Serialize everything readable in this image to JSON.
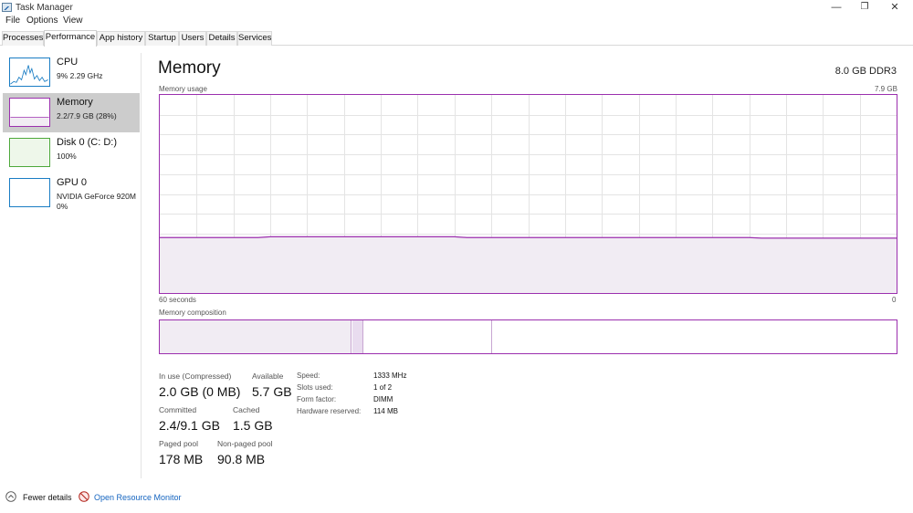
{
  "window": {
    "title": "Task Manager",
    "buttons": {
      "minimize": "—",
      "restore": "❐",
      "close": "✕"
    }
  },
  "menu": [
    "File",
    "Options",
    "View"
  ],
  "tabs": [
    "Processes",
    "Performance",
    "App history",
    "Startup",
    "Users",
    "Details",
    "Services"
  ],
  "active_tab": "Performance",
  "sidebar": {
    "items": [
      {
        "name": "CPU",
        "sub1": "9% 2.29 GHz",
        "sub2": "",
        "icon": "cpu-graph-thumbnail",
        "color": "#1a7dc4"
      },
      {
        "name": "Memory",
        "sub1": "2.2/7.9 GB (28%)",
        "sub2": "",
        "icon": "memory-graph-thumbnail",
        "color": "#9b2fae"
      },
      {
        "name": "Disk 0 (C: D:)",
        "sub1": "100%",
        "sub2": "",
        "icon": "disk-graph-thumbnail",
        "color": "#4da83a"
      },
      {
        "name": "GPU 0",
        "sub1": "NVIDIA GeForce 920M",
        "sub2": "0%",
        "icon": "gpu-graph-thumbnail",
        "color": "#1a7dc4"
      }
    ],
    "selected": "Memory"
  },
  "main": {
    "title": "Memory",
    "spec": "8.0 GB DDR3",
    "usage_label": "Memory usage",
    "usage_max": "7.9 GB",
    "time_left": "60 seconds",
    "time_right": "0",
    "composition_label": "Memory composition",
    "usage_fraction": 0.28
  },
  "stats": {
    "in_use_label": "In use (Compressed)",
    "in_use": "2.0 GB (0 MB)",
    "available_label": "Available",
    "available": "5.7 GB",
    "committed_label": "Committed",
    "committed": "2.4/9.1 GB",
    "cached_label": "Cached",
    "cached": "1.5 GB",
    "paged_label": "Paged pool",
    "paged": "178 MB",
    "nonpaged_label": "Non-paged pool",
    "nonpaged": "90.8 MB"
  },
  "specs": {
    "speed_label": "Speed:",
    "speed": "1333 MHz",
    "slots_label": "Slots used:",
    "slots": "1 of 2",
    "form_label": "Form factor:",
    "form": "DIMM",
    "reserved_label": "Hardware reserved:",
    "reserved": "114 MB"
  },
  "footer": {
    "fewer_details": "Fewer details",
    "open_monitor": "Open Resource Monitor"
  },
  "colors": {
    "memory": "#9b2fae",
    "memory_fill": "#f1ecf3",
    "grid": "#e4e4e4",
    "link": "#1565c0"
  }
}
